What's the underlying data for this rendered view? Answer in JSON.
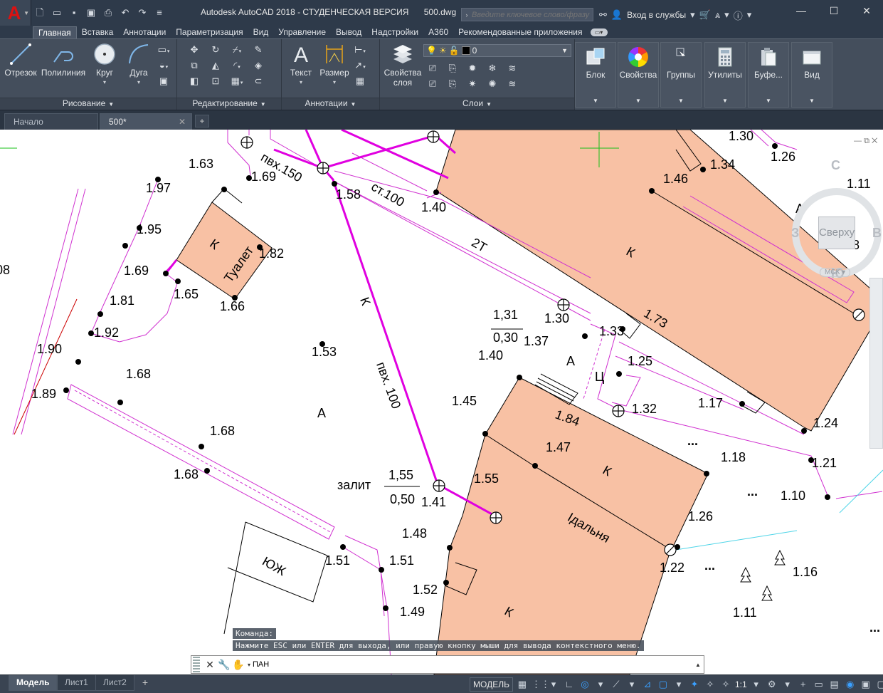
{
  "window": {
    "app_name": "Autodesk AutoCAD 2018 - СТУДЕНЧЕСКАЯ ВЕРСИЯ",
    "file_name": "500.dwg",
    "search_placeholder": "Введите ключевое слово/фразу",
    "signin_label": "Вход в службы"
  },
  "ribbon_tabs": [
    "Главная",
    "Вставка",
    "Аннотации",
    "Параметризация",
    "Вид",
    "Управление",
    "Вывод",
    "Надстройки",
    "A360",
    "Рекомендованные приложения"
  ],
  "ribbon": {
    "draw": {
      "title": "Рисование",
      "line": "Отрезок",
      "polyline": "Полилиния",
      "circle": "Круг",
      "arc": "Дуга"
    },
    "modify": {
      "title": "Редактирование"
    },
    "annotation": {
      "title": "Аннотации",
      "text": "Текст",
      "dimension": "Размер"
    },
    "layers": {
      "title": "Слои",
      "properties_line1": "Свойства",
      "properties_line2": "слоя",
      "current_layer": "0"
    },
    "block": "Блок",
    "properties": "Свойства",
    "groups": "Группы",
    "utilities": "Утилиты",
    "clipboard": "Буфе...",
    "view": "Вид"
  },
  "file_tabs": {
    "start": "Начало",
    "current": "500*"
  },
  "drawing_labels": [
    {
      "t": "1.63"
    },
    {
      "t": "1.69"
    },
    {
      "t": "пвх.150"
    },
    {
      "t": "1.58"
    },
    {
      "t": "ст.100"
    },
    {
      "t": "1.40"
    },
    {
      "t": "1.46"
    },
    {
      "t": "1.34"
    },
    {
      "t": "1.30"
    },
    {
      "t": "1.26"
    },
    {
      "t": "1.97"
    },
    {
      "t": "1.95"
    },
    {
      "t": "К"
    },
    {
      "t": "Туалет"
    },
    {
      "t": "1.82"
    },
    {
      "t": "1.69"
    },
    {
      "t": "1.65"
    },
    {
      "t": "1.81"
    },
    {
      "t": "1.66"
    },
    {
      "t": "1.92"
    },
    {
      "t": "1.90"
    },
    {
      "t": "1.53"
    },
    {
      "t": "1.68"
    },
    {
      "t": "1.89"
    },
    {
      "t": "А"
    },
    {
      "t": "1.68"
    },
    {
      "t": "1.68"
    },
    {
      "t": "К"
    },
    {
      "t": "пвх. 100"
    },
    {
      "t": "2Т"
    },
    {
      "t": "К"
    },
    {
      "t": "1,31"
    },
    {
      "t": "0,30"
    },
    {
      "t": "1.30"
    },
    {
      "t": "1.37"
    },
    {
      "t": "1.33"
    },
    {
      "t": "1.73"
    },
    {
      "t": "1.40"
    },
    {
      "t": "А"
    },
    {
      "t": "Ц"
    },
    {
      "t": "1.25"
    },
    {
      "t": "1.45"
    },
    {
      "t": "1.84"
    },
    {
      "t": "1.32"
    },
    {
      "t": "1.17"
    },
    {
      "t": "1.24"
    },
    {
      "t": "1.47"
    },
    {
      "t": "К"
    },
    {
      "t": "1.18"
    },
    {
      "t": "1.21"
    },
    {
      "t": "залит"
    },
    {
      "t": "1,55"
    },
    {
      "t": "0,50"
    },
    {
      "t": "1.41"
    },
    {
      "t": "1.55"
    },
    {
      "t": "1.10"
    },
    {
      "t": "Ідальня"
    },
    {
      "t": "1.26"
    },
    {
      "t": "1.48"
    },
    {
      "t": "1.51"
    },
    {
      "t": "1.51"
    },
    {
      "t": "ЮЖ"
    },
    {
      "t": "1.22"
    },
    {
      "t": "1.16"
    },
    {
      "t": "1.52"
    },
    {
      "t": "1.49"
    },
    {
      "t": "К"
    },
    {
      "t": "1.11"
    },
    {
      "t": "1.11"
    },
    {
      "t": "1.18"
    },
    {
      "t": "А"
    },
    {
      "t": "08"
    },
    {
      "t": "..."
    },
    {
      "t": "..."
    },
    {
      "t": "..."
    },
    {
      "t": "..."
    },
    {
      "t": "1"
    }
  ],
  "viewcube": {
    "north": "С",
    "south": "Ю",
    "west": "З",
    "east": "В",
    "face": "Сверху",
    "ucs": "МСК"
  },
  "command": {
    "history_1": "Команда:",
    "history_2": "Нажмите ESC или ENTER для выхода, или правую кнопку мыши для вывода контекстного меню.",
    "current": "ПАН"
  },
  "layout_tabs": [
    "Модель",
    "Лист1",
    "Лист2"
  ],
  "status": {
    "mode": "МОДЕЛЬ",
    "scale": "1:1"
  },
  "colors": {
    "building_fill": "#f8c1a4",
    "pipe": "#e000e0",
    "thin": "#d030d0",
    "ribbon_bg": "#444e5c"
  }
}
